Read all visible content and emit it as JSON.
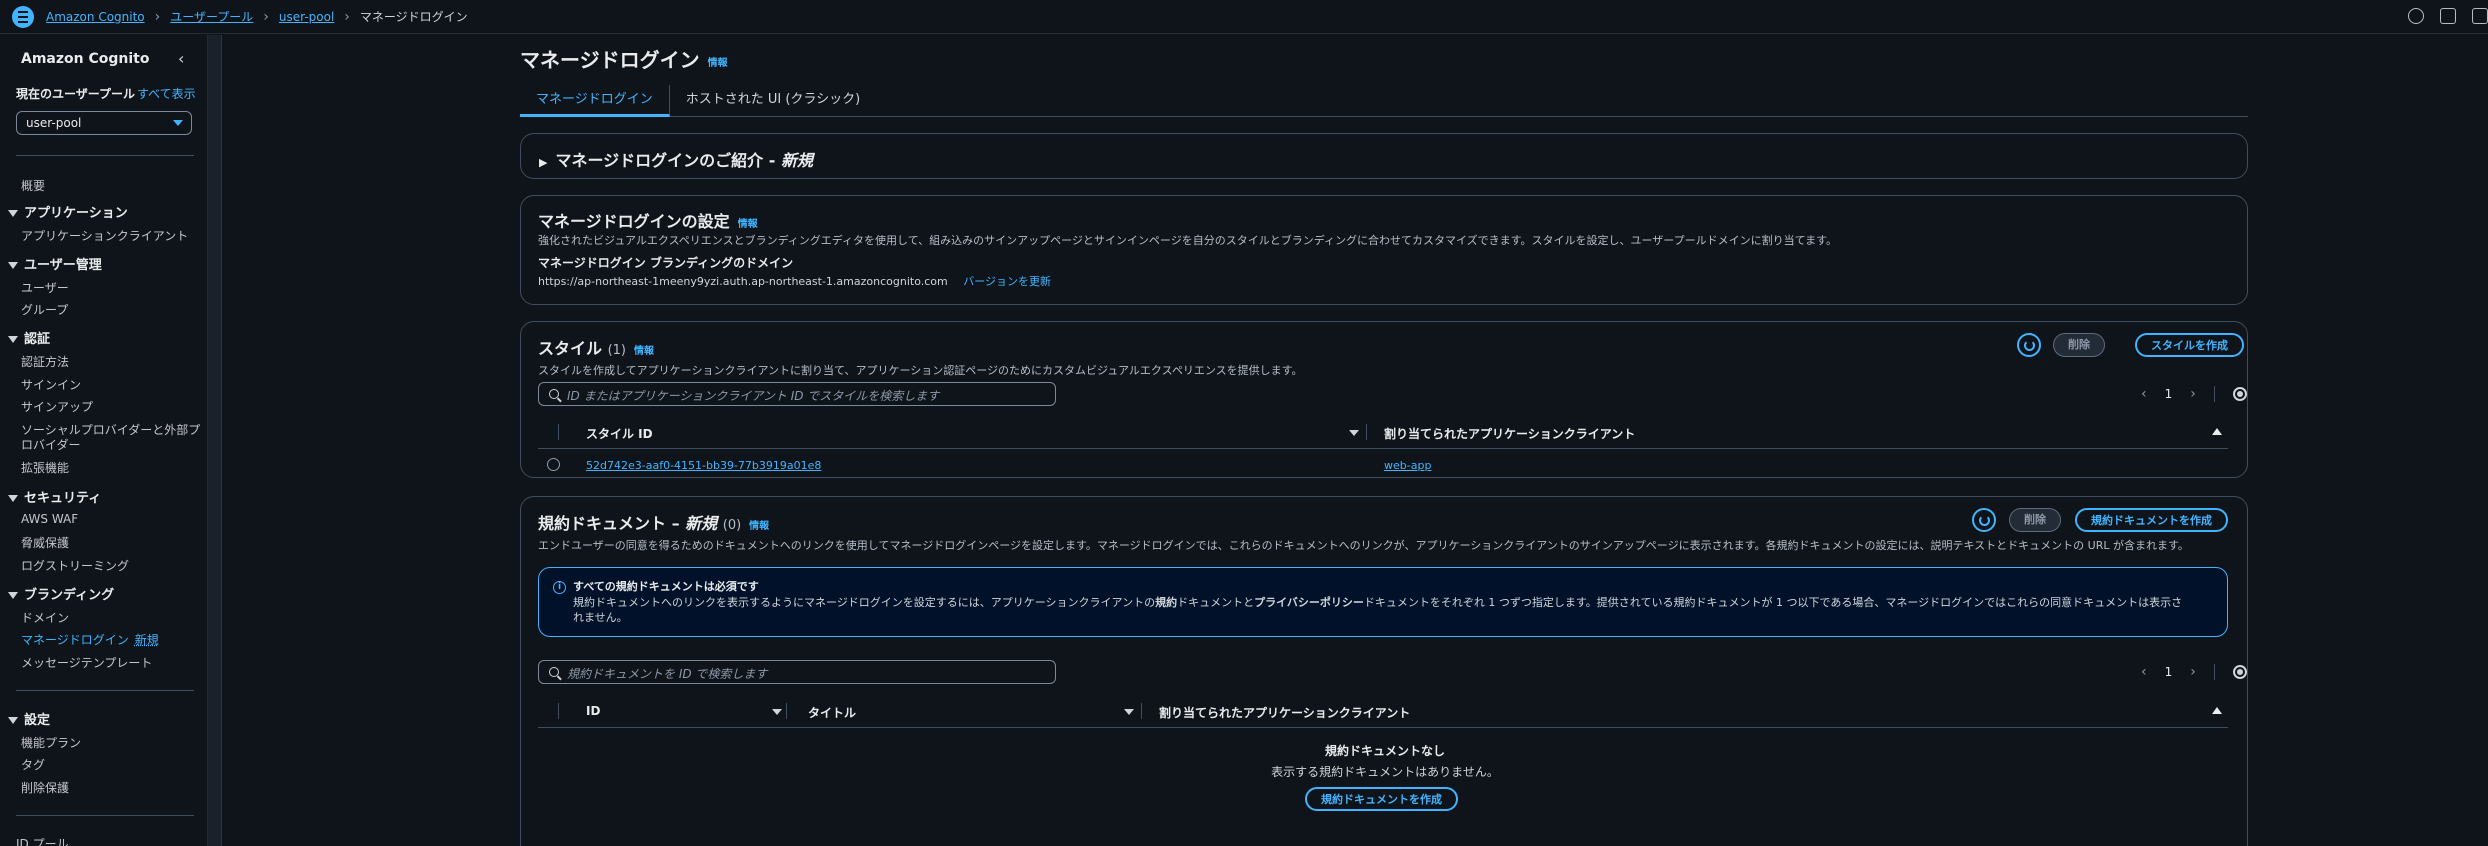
{
  "breadcrumb": {
    "items": [
      "Amazon Cognito",
      "ユーザープール",
      "user-pool"
    ],
    "current": "マネージドログイン"
  },
  "sidebar": {
    "title": "Amazon Cognito",
    "pool_label": "現在のユーザープール",
    "pool_all": "すべて表示",
    "pool_value": "user-pool",
    "overview": "概要",
    "sections": {
      "apps": {
        "heading": "アプリケーション",
        "items": [
          "アプリケーションクライアント"
        ]
      },
      "users": {
        "heading": "ユーザー管理",
        "items": [
          "ユーザー",
          "グループ"
        ]
      },
      "auth": {
        "heading": "認証",
        "items": [
          "認証方法",
          "サインイン",
          "サインアップ",
          "ソーシャルプロバイダーと外部プ",
          "ロバイダー",
          "拡張機能"
        ]
      },
      "security": {
        "heading": "セキュリティ",
        "items": [
          "AWS WAF",
          "脅威保護",
          "ログストリーミング"
        ]
      },
      "branding": {
        "heading": "ブランディング",
        "items": [
          "ドメイン",
          "マネージドログイン",
          "メッセージテンプレート"
        ],
        "new_tag": "新規"
      },
      "settings": {
        "heading": "設定",
        "items": [
          "機能プラン",
          "タグ",
          "削除保護"
        ]
      }
    },
    "id_pool": "ID プール"
  },
  "page": {
    "title": "マネージドログイン",
    "info": "情報",
    "tabs": [
      "マネージドログイン",
      "ホストされた UI (クラシック)"
    ]
  },
  "intro": {
    "title": "マネージドログインのご紹介 - ",
    "title_new": "新規"
  },
  "settings_card": {
    "title": "マネージドログインの設定",
    "info": "情報",
    "description": "強化されたビジュアルエクスペリエンスとブランディングエディタを使用して、組み込みのサインアップページとサインインページを自分のスタイルとブランディングに合わせてカスタマイズできます。スタイルを設定し、ユーザープールドメインに割り当てます。",
    "domain_label": "マネージドログイン ブランディングのドメイン",
    "domain_value": "https://ap-northeast-1meeny9yzi.auth.ap-northeast-1.amazoncognito.com",
    "update_version": "バージョンを更新"
  },
  "styles_card": {
    "title": "スタイル",
    "count": "(1)",
    "info": "情報",
    "description": "スタイルを作成してアプリケーションクライアントに割り当て、アプリケーション認証ページのためにカスタムビジュアルエクスペリエンスを提供します。",
    "delete": "削除",
    "create": "スタイルを作成",
    "search_placeholder": "ID またはアプリケーションクライアント ID でスタイルを検索します",
    "page": "1",
    "columns": [
      "スタイル ID",
      "割り当てられたアプリケーションクライアント"
    ],
    "rows": [
      {
        "id": "52d742e3-aaf0-4151-bb39-77b3919a01e8",
        "client": "web-app"
      }
    ]
  },
  "terms_card": {
    "title": "規約ドキュメント – ",
    "title_new": "新規",
    "count": "(0)",
    "info": "情報",
    "description": "エンドユーザーの同意を得るためのドキュメントへのリンクを使用してマネージドログインページを設定します。マネージドログインでは、これらのドキュメントへのリンクが、アプリケーションクライアントのサインアップページに表示されます。各規約ドキュメントの設定には、説明テキストとドキュメントの URL が含まれます。",
    "delete": "削除",
    "create": "規約ドキュメントを作成",
    "alert_title": "すべての規約ドキュメントは必須です",
    "alert_body_1": "規約ドキュメントへのリンクを表示するようにマネージドログインを設定するには、アプリケーションクライアントの",
    "alert_bold_1": "規約",
    "alert_body_2": "ドキュメントと",
    "alert_bold_2": "プライバシーポリシー",
    "alert_body_3": "ドキュメントをそれぞれ 1 つずつ指定します。提供されている規約ドキュメントが 1 つ以下である場合、マネージドログインではこれらの同意ドキュメントは表示さ",
    "alert_body_4": "れません。",
    "search_placeholder": "規約ドキュメントを ID で検索します",
    "page": "1",
    "columns": [
      "ID",
      "タイトル",
      "割り当てられたアプリケーションクライアント"
    ],
    "empty_title": "規約ドキュメントなし",
    "empty_body": "表示する規約ドキュメントはありません。",
    "empty_button": "規約ドキュメントを作成"
  }
}
